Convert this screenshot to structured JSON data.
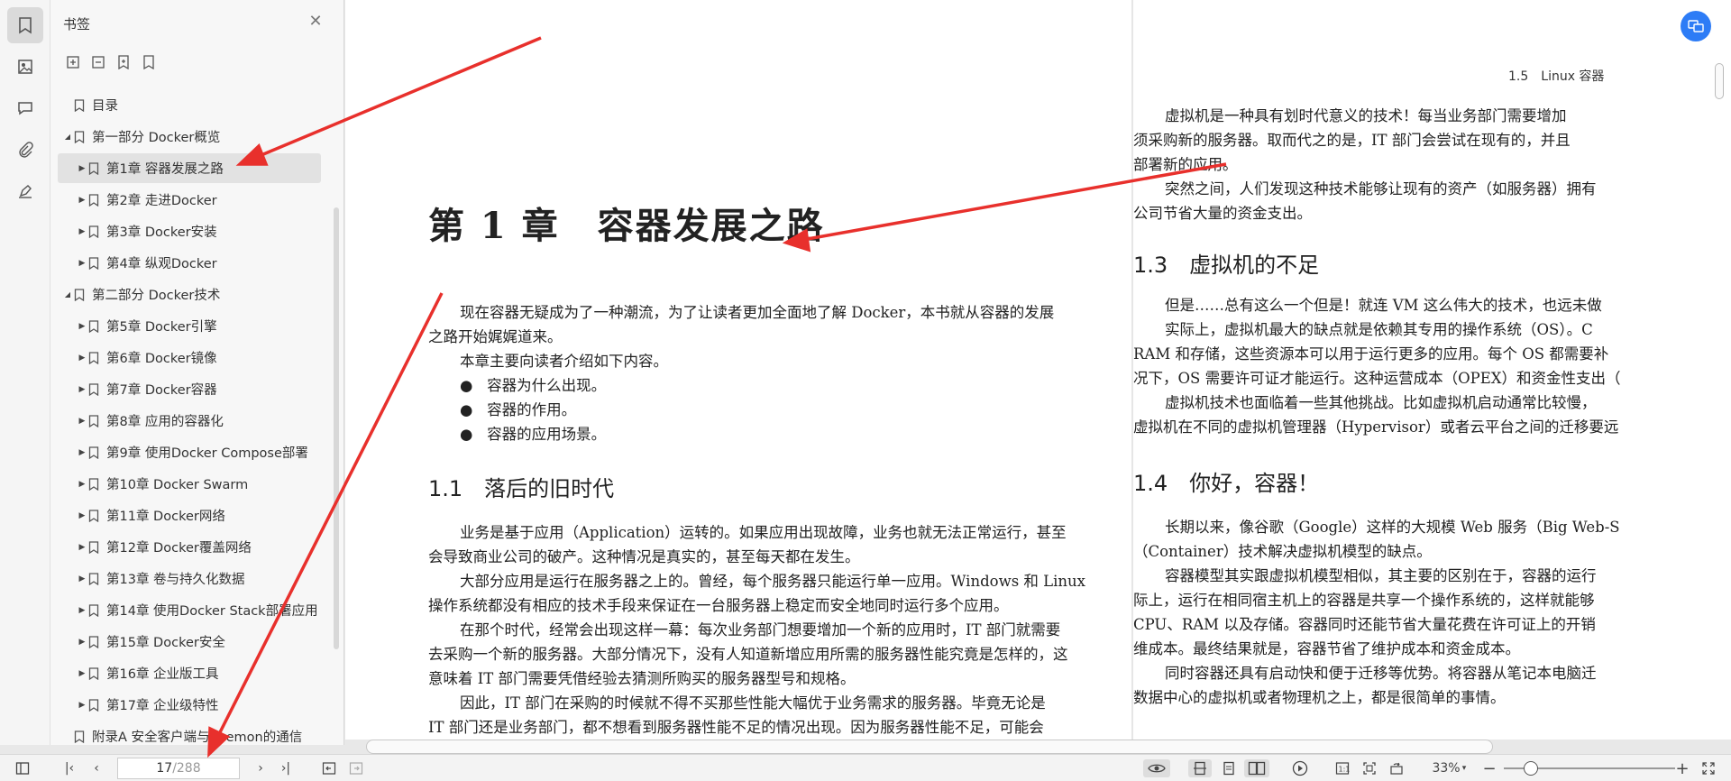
{
  "panel": {
    "title": "书签",
    "toc": [
      {
        "label": "目录",
        "level": 0,
        "expand": "none"
      },
      {
        "label": "第一部分 Docker概览",
        "level": 0,
        "expand": "open"
      },
      {
        "label": "第1章 容器发展之路",
        "level": 1,
        "expand": "closed",
        "selected": true
      },
      {
        "label": "第2章 走进Docker",
        "level": 1,
        "expand": "closed"
      },
      {
        "label": "第3章 Docker安装",
        "level": 1,
        "expand": "closed"
      },
      {
        "label": "第4章 纵观Docker",
        "level": 1,
        "expand": "closed"
      },
      {
        "label": "第二部分 Docker技术",
        "level": 0,
        "expand": "open"
      },
      {
        "label": "第5章 Docker引擎",
        "level": 1,
        "expand": "closed"
      },
      {
        "label": "第6章 Docker镜像",
        "level": 1,
        "expand": "closed"
      },
      {
        "label": "第7章 Docker容器",
        "level": 1,
        "expand": "closed"
      },
      {
        "label": "第8章 应用的容器化",
        "level": 1,
        "expand": "closed"
      },
      {
        "label": "第9章 使用Docker Compose部署",
        "level": 1,
        "expand": "closed"
      },
      {
        "label": "第10章 Docker Swarm",
        "level": 1,
        "expand": "closed"
      },
      {
        "label": "第11章 Docker网络",
        "level": 1,
        "expand": "closed"
      },
      {
        "label": "第12章 Docker覆盖网络",
        "level": 1,
        "expand": "closed"
      },
      {
        "label": "第13章 卷与持久化数据",
        "level": 1,
        "expand": "closed"
      },
      {
        "label": "第14章 使用Docker Stack部署应用",
        "level": 1,
        "expand": "closed"
      },
      {
        "label": "第15章 Docker安全",
        "level": 1,
        "expand": "closed"
      },
      {
        "label": "第16章 企业版工具",
        "level": 1,
        "expand": "closed"
      },
      {
        "label": "第17章 企业级特性",
        "level": 1,
        "expand": "closed"
      },
      {
        "label": "附录A 安全客户端与daemon的通信",
        "level": 0,
        "expand": "none"
      }
    ]
  },
  "left_page": {
    "chapter_title": "第 1 章　容器发展之路",
    "intro": [
      "现在容器无疑成为了一种潮流，为了让读者更加全面地了解 Docker，本书就从容器的发展",
      "之路开始娓娓道来。",
      "本章主要向读者介绍如下内容。"
    ],
    "bullets": [
      "容器为什么出现。",
      "容器的作用。",
      "容器的应用场景。"
    ],
    "section_heading": "1.1　落后的旧时代",
    "paragraphs": [
      "业务是基于应用（Application）运转的。如果应用出现故障，业务也就无法正常运行，甚至",
      "会导致商业公司的破产。这种情况是真实的，甚至每天都在发生。",
      "大部分应用是运行在服务器之上的。曾经，每个服务器只能运行单一应用。Windows 和 Linux",
      "操作系统都没有相应的技术手段来保证在一台服务器上稳定而安全地同时运行多个应用。",
      "在那个时代，经常会出现这样一幕：每次业务部门想要增加一个新的应用时，IT 部门就需要",
      "去采购一个新的服务器。大部分情况下，没有人知道新增应用所需的服务器性能究竟是怎样的，这",
      "意味着 IT 部门需要凭借经验去猜测所购买的服务器型号和规格。",
      "因此，IT 部门在采购的时候就不得不买那些性能大幅优于业务需求的服务器。毕竟无论是",
      "IT 部门还是业务部门，都不想看到服务器性能不足的情况出现。因为服务器性能不足，可能会"
    ]
  },
  "right_page": {
    "running_head": "1.5　Linux 容器",
    "lines_a": [
      "虚拟机是一种具有划时代意义的技术！每当业务部门需要增加",
      "须采购新的服务器。取而代之的是，IT 部门会尝试在现有的，并且",
      "部署新的应用。",
      "突然之间，人们发现这种技术能够让现有的资产（如服务器）拥有",
      "公司节省大量的资金支出。"
    ],
    "heading_13": "1.3　虚拟机的不足",
    "lines_b": [
      "但是……总有这么一个但是！就连 VM 这么伟大的技术，也远未做",
      "实际上，虚拟机最大的缺点就是依赖其专用的操作系统（OS）。C",
      "RAM 和存储，这些资源本可以用于运行更多的应用。每个 OS 都需要补",
      "况下，OS 需要许可证才能运行。这种运营成本（OPEX）和资金性支出（",
      "虚拟机技术也面临着一些其他挑战。比如虚拟机启动通常比较慢，",
      "虚拟机在不同的虚拟机管理器（Hypervisor）或者云平台之间的迁移要远"
    ],
    "heading_14": "1.4　你好，容器！",
    "lines_c": [
      "长期以来，像谷歌（Google）这样的大规模 Web 服务（Big Web-S",
      "（Container）技术解决虚拟机模型的缺点。",
      "容器模型其实跟虚拟机模型相似，其主要的区别在于，容器的运行",
      "际上，运行在相同宿主机上的容器是共享一个操作系统的，这样就能够",
      "CPU、RAM 以及存储。容器同时还能节省大量花费在许可证上的开销",
      "维成本。最终结果就是，容器节省了维护成本和资金成本。",
      "同时容器还具有启动快和便于迁移等优势。将容器从笔记本电脑迁",
      "数据中心的虚拟机或者物理机之上，都是很简单的事情。"
    ]
  },
  "statusbar": {
    "page_current": "17",
    "page_total": "/288",
    "zoom": "33%"
  },
  "colors": {
    "accent": "#2d7cf6",
    "annotation": "#e8302c"
  }
}
